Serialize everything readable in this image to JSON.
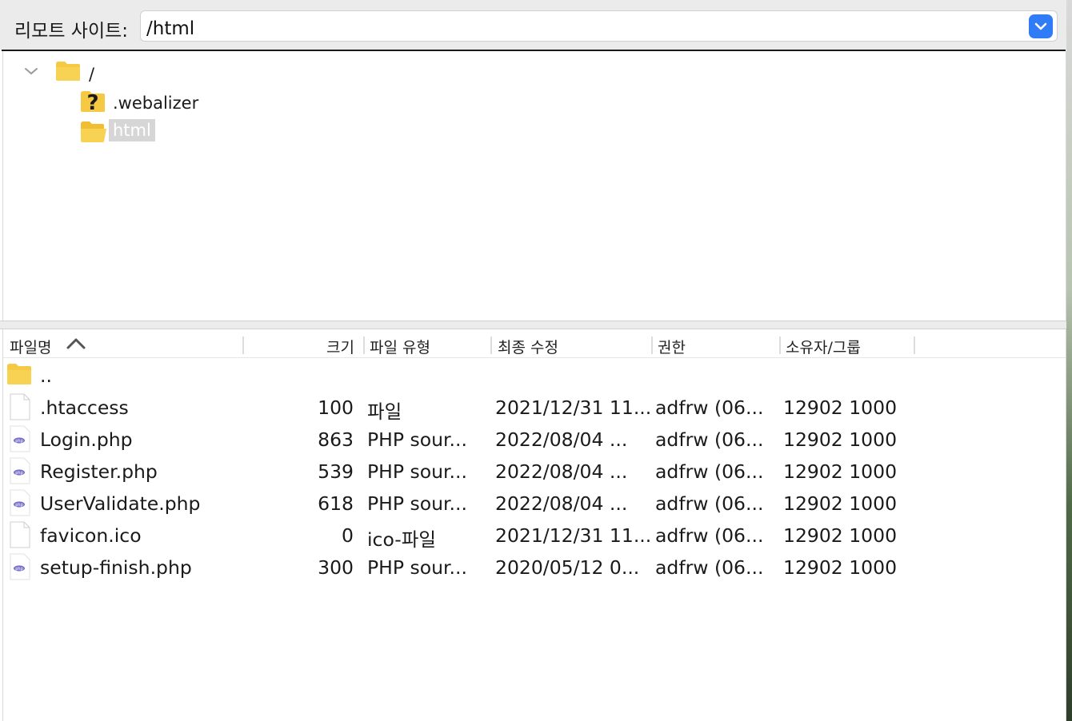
{
  "remote_site": {
    "label": "리모트 사이트:",
    "path_value": "/html"
  },
  "tree": {
    "items": [
      {
        "label": "/",
        "icon": "folder-icon",
        "expanded": true
      },
      {
        "label": ".webalizer",
        "icon": "unknown-folder-icon"
      },
      {
        "label": "html",
        "icon": "open-folder-icon",
        "selected": true
      }
    ]
  },
  "file_list": {
    "columns": [
      {
        "label": "파일명",
        "sort": "ascending"
      },
      {
        "label": "크기"
      },
      {
        "label": "파일 유형"
      },
      {
        "label": "최종 수정"
      },
      {
        "label": "권한"
      },
      {
        "label": "소유자/그룹"
      }
    ],
    "rows": [
      {
        "name": "..",
        "size": "",
        "type": "",
        "modified": "",
        "perms": "",
        "owner": "",
        "icon": "folder-icon"
      },
      {
        "name": ".htaccess",
        "size": "100",
        "type": "파일",
        "modified": "2021/12/31 11...",
        "perms": "adfrw (06...",
        "owner": "12902 1000",
        "icon": "file-icon"
      },
      {
        "name": "Login.php",
        "size": "863",
        "type": "PHP sour...",
        "modified": "2022/08/04 ...",
        "perms": "adfrw (06...",
        "owner": "12902 1000",
        "icon": "php-file-icon"
      },
      {
        "name": "Register.php",
        "size": "539",
        "type": "PHP sour...",
        "modified": "2022/08/04 ...",
        "perms": "adfrw (06...",
        "owner": "12902 1000",
        "icon": "php-file-icon"
      },
      {
        "name": "UserValidate.php",
        "size": "618",
        "type": "PHP sour...",
        "modified": "2022/08/04 ...",
        "perms": "adfrw (06...",
        "owner": "12902 1000",
        "icon": "php-file-icon"
      },
      {
        "name": "favicon.ico",
        "size": "0",
        "type": "ico-파일",
        "modified": "2021/12/31 11...",
        "perms": "adfrw (06...",
        "owner": "12902 1000",
        "icon": "file-icon"
      },
      {
        "name": "setup-finish.php",
        "size": "300",
        "type": "PHP sour...",
        "modified": "2020/05/12 0...",
        "perms": "adfrw (06...",
        "owner": "12902 1000",
        "icon": "php-file-icon"
      }
    ]
  },
  "colors": {
    "accent": "#2f7cf6",
    "folder": "#f5c842",
    "selection": "#d6d6d6"
  }
}
